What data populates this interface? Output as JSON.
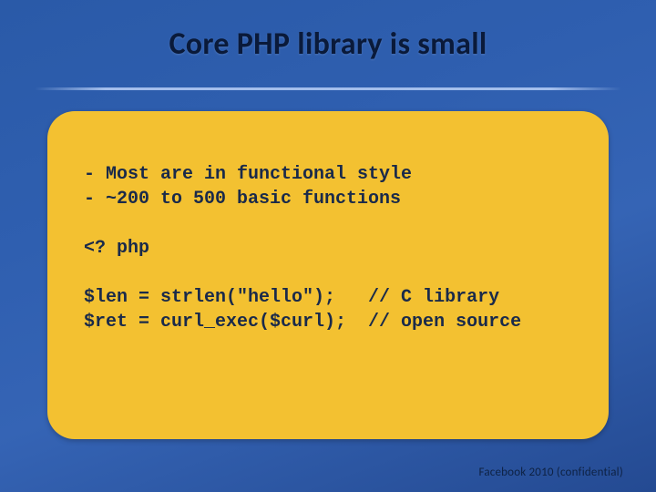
{
  "slide": {
    "title": "Core PHP library is small",
    "code_lines": {
      "l1": "- Most are in functional style",
      "l2": "- ~200 to 500 basic functions",
      "blank1": "",
      "l3": "<? php",
      "blank2": "",
      "l4": "$len = strlen(\"hello\");   // C library",
      "l5": "$ret = curl_exec($curl);  // open source"
    },
    "footer": "Facebook 2010 (confidential)"
  }
}
